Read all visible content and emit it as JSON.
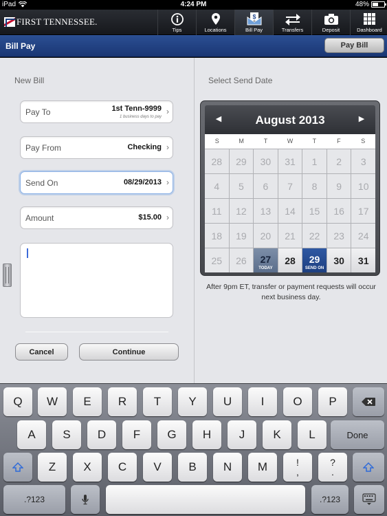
{
  "status_bar": {
    "device": "iPad",
    "time": "4:24 PM",
    "battery": "48%",
    "battery_level": 0.48
  },
  "header": {
    "brand": "FIRST TENNESSEE.",
    "tabs": [
      {
        "label": "Tips",
        "icon": "info-icon"
      },
      {
        "label": "Locations",
        "icon": "map-pin-icon"
      },
      {
        "label": "Bill Pay",
        "icon": "bill-envelope-icon"
      },
      {
        "label": "Transfers",
        "icon": "transfer-arrows-icon"
      },
      {
        "label": "Deposit",
        "icon": "camera-icon"
      },
      {
        "label": "Dashboard",
        "icon": "grid-icon"
      }
    ]
  },
  "title_bar": {
    "title": "Bill Pay",
    "pay_bill_button": "Pay Bill"
  },
  "new_bill": {
    "heading": "New Bill",
    "pay_to": {
      "label": "Pay To",
      "value": "1st Tenn-9999",
      "sub": "1 business days to pay"
    },
    "pay_from": {
      "label": "Pay From",
      "value": "Checking"
    },
    "send_on": {
      "label": "Send On",
      "value": "08/29/2013"
    },
    "amount": {
      "label": "Amount",
      "value": "$15.00"
    },
    "memo": {
      "value": ""
    },
    "cancel_button": "Cancel",
    "continue_button": "Continue"
  },
  "send_date": {
    "heading": "Select Send Date",
    "month": "August 2013",
    "prev": "◀",
    "next": "▶",
    "days_of_week": [
      "S",
      "M",
      "T",
      "W",
      "T",
      "F",
      "S"
    ],
    "weeks": [
      [
        "28",
        "29",
        "30",
        "31",
        "1",
        "2",
        "3"
      ],
      [
        "4",
        "5",
        "6",
        "7",
        "8",
        "9",
        "10"
      ],
      [
        "11",
        "12",
        "13",
        "14",
        "15",
        "16",
        "17"
      ],
      [
        "18",
        "19",
        "20",
        "21",
        "22",
        "23",
        "24"
      ],
      [
        "25",
        "26",
        "27",
        "28",
        "29",
        "30",
        "31"
      ]
    ],
    "today_label": "TODAY",
    "send_on_label": "SEND ON",
    "notice": "After 9pm ET, transfer or payment requests will occur next business day."
  },
  "keyboard": {
    "row1": [
      "Q",
      "W",
      "E",
      "R",
      "T",
      "Y",
      "U",
      "I",
      "O",
      "P"
    ],
    "row2": [
      "A",
      "S",
      "D",
      "F",
      "G",
      "H",
      "J",
      "K",
      "L"
    ],
    "return_key": "Done",
    "row3": [
      "Z",
      "X",
      "C",
      "V",
      "B",
      "N",
      "M"
    ],
    "punct1_top": "!",
    "punct1_bottom": ",",
    "punct2_top": "?",
    "punct2_bottom": ".",
    "numbers_key": ".?123"
  }
}
